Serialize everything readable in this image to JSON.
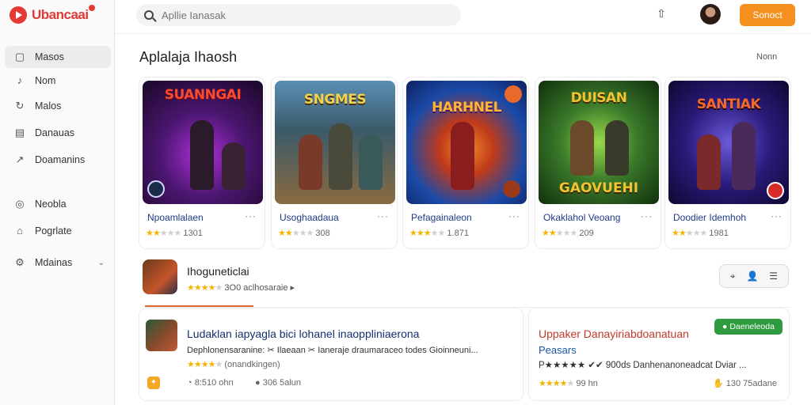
{
  "app": {
    "name": "Ubancaai"
  },
  "sidebar": {
    "items": [
      {
        "label": "Masos",
        "icon": "square-icon"
      },
      {
        "label": "Nom",
        "icon": "music-note-icon"
      },
      {
        "label": "Malos",
        "icon": "refresh-icon"
      },
      {
        "label": "Danauas",
        "icon": "document-icon"
      },
      {
        "label": "Doamanins",
        "icon": "trend-icon"
      },
      {
        "label": "Neobla",
        "icon": "compass-icon"
      },
      {
        "label": "Pogrlate",
        "icon": "tag-icon"
      },
      {
        "label": "Mdainas",
        "icon": "gear-icon"
      }
    ]
  },
  "search": {
    "placeholder": "Apllie Ianasak"
  },
  "header": {
    "primary_button": "Sonoct"
  },
  "section": {
    "title": "Aplalaja Ihaosh",
    "more": "Nonn"
  },
  "cards": [
    {
      "thumb_title": "SUANNGAI",
      "name": "Npoamlalaen",
      "rating": 2,
      "count": "1301",
      "colors": [
        "#2a0f3d",
        "#7a1f9a",
        "#e53935"
      ]
    },
    {
      "thumb_title": "SNGMES",
      "name": "Usoghaadaua",
      "rating": 2,
      "count": "308",
      "colors": [
        "#1b3a4a",
        "#7a6a4a",
        "#d9b45a"
      ]
    },
    {
      "thumb_title": "HARHNEL",
      "name": "Pefagainaleon",
      "rating": 3,
      "count": "1.871",
      "colors": [
        "#123a8a",
        "#3a7ad9",
        "#e0551f"
      ]
    },
    {
      "thumb_title": "DUISAN",
      "name": "Okaklahol Veoang",
      "rating": 2,
      "count": "209",
      "colors": [
        "#1d3a1a",
        "#5a8a2a",
        "#f2c230"
      ]
    },
    {
      "thumb_title": "SANTIAK",
      "name": "Doodier Idemhoh",
      "rating": 2,
      "count": "1981",
      "colors": [
        "#1a1a5a",
        "#4a2a8a",
        "#d94a2a"
      ]
    }
  ],
  "card_subtitles": {
    "c3": "GAOVUEHI"
  },
  "featured": {
    "title": "Ihoguneticlai",
    "meta": "3O0 aclhosaraie ▸",
    "rating": 4
  },
  "segment": {
    "a": "⌖",
    "b": "👤",
    "c": "☰"
  },
  "panel1": {
    "title": "Ludaklan iapyagla bici lohanel inaoppliniaerona",
    "desc": "Dephlonensaranine: ✂ Ilaeaan ✂ Ianeraje draumaraceo todes Gioinneuni...",
    "rating_label": "(onandkingen)",
    "rating": 4,
    "stat1": "8:510 ohn",
    "stat2": "306 5alun"
  },
  "panel2": {
    "title": "Uppaker  Danayiriabdoanatuan",
    "subtitle": "Peasars",
    "line": "P★★★★★ ✔✔ 900ds Danhenanoneadcat Dviar ...",
    "tag": "Daeneleoda",
    "rating_count": "99 hn",
    "rating": 4,
    "stat": "130 75adane"
  }
}
